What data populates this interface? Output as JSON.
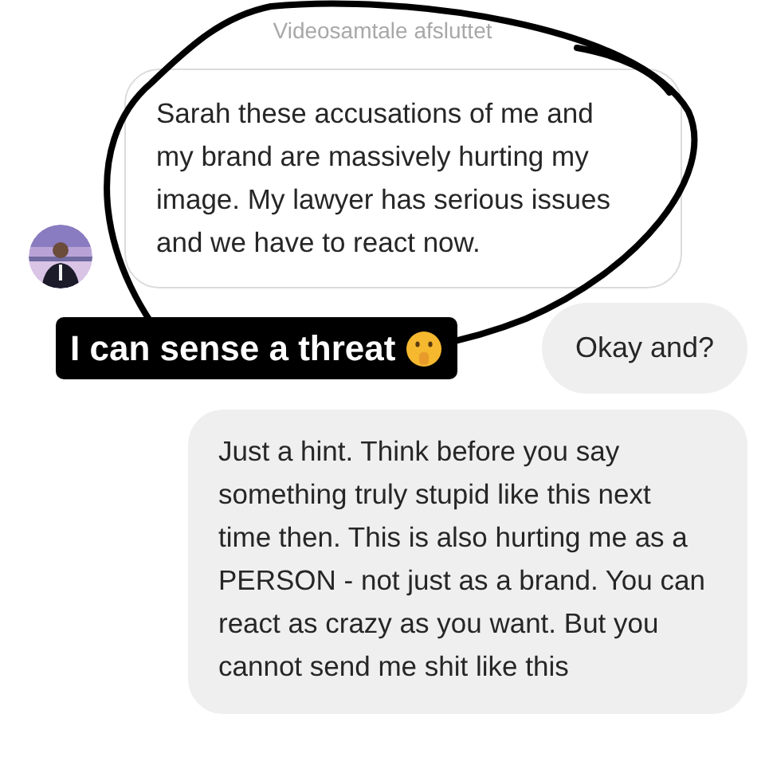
{
  "system_notice": "Videosamtale afsluttet",
  "messages": [
    {
      "kind": "received",
      "text": "Sarah these accusations of me and my brand are massively hurting my image. My lawyer has serious issues and we have to react now."
    },
    {
      "kind": "sent",
      "text": "Okay and?"
    },
    {
      "kind": "sent",
      "text": "Just a hint. Think before you say something truly stupid like this next time then. This is also hurting me as a PERSON - not just as a brand. You can react as crazy as you want. But you cannot send me shit like this"
    }
  ],
  "caption": "I can sense a threat"
}
